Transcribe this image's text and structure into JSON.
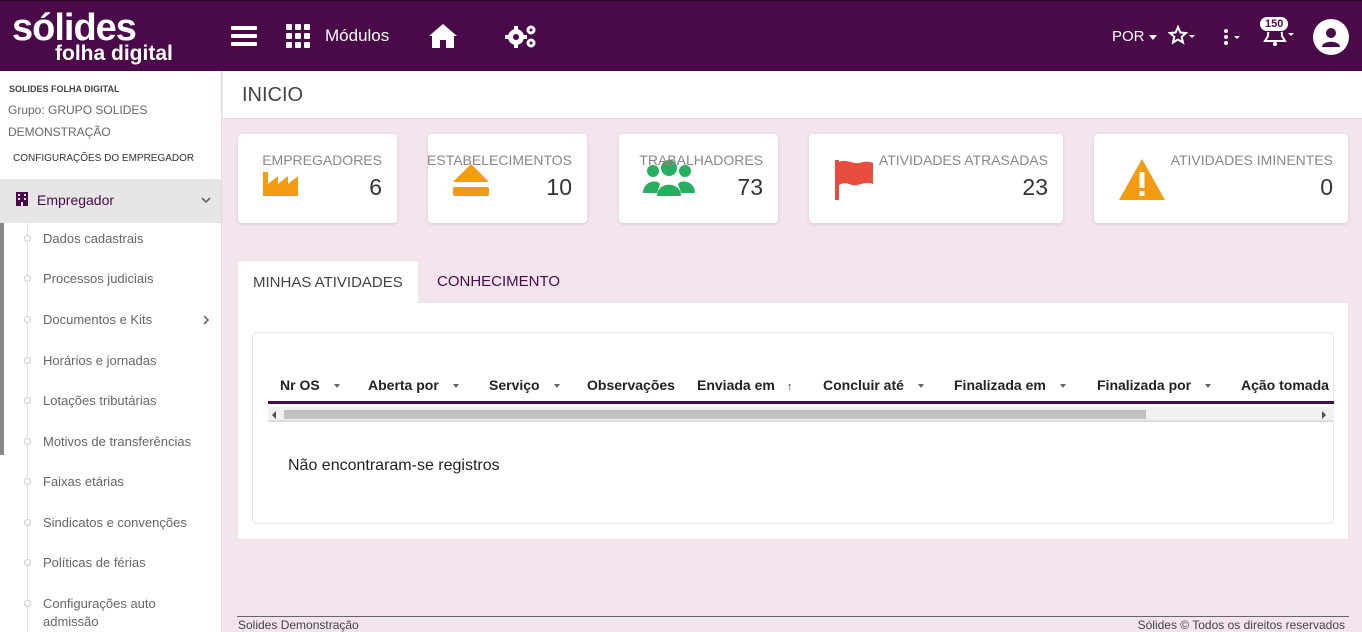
{
  "header": {
    "logo_main": "sólides",
    "logo_sub": "folha digital",
    "modules_label": "Módulos",
    "language": "POR",
    "notifications_count": "150"
  },
  "sidebar": {
    "company": "SOLIDES FOLHA DIGITAL",
    "group": "Grupo: GRUPO SOLIDES DEMONSTRAÇÃO",
    "config_title": "CONFIGURAÇÕES DO EMPREGADOR",
    "active_section": "Empregador",
    "items": [
      {
        "label": "Dados cadastrais",
        "has_submenu": false
      },
      {
        "label": "Processos judiciais",
        "has_submenu": false
      },
      {
        "label": "Documentos e Kits",
        "has_submenu": true
      },
      {
        "label": "Horários e jornadas",
        "has_submenu": false
      },
      {
        "label": "Lotações tributárias",
        "has_submenu": false
      },
      {
        "label": "Motivos de transferências",
        "has_submenu": false
      },
      {
        "label": "Faixas etárias",
        "has_submenu": false
      },
      {
        "label": "Sindicatos e convenções",
        "has_submenu": false
      },
      {
        "label": "Políticas de férias",
        "has_submenu": false
      },
      {
        "label": "Configurações auto admissão",
        "has_submenu": false
      }
    ]
  },
  "page": {
    "title": "INICIO"
  },
  "cards": [
    {
      "label": "EMPREGADORES",
      "value": "6",
      "icon": "factory-icon",
      "color": "#f39c12"
    },
    {
      "label": "ESTABELECIMENTOS",
      "value": "10",
      "icon": "eject-icon",
      "color": "#f39c12"
    },
    {
      "label": "TRABALHADORES",
      "value": "73",
      "icon": "users-icon",
      "color": "#27ae60"
    },
    {
      "label": "ATIVIDADES ATRASADAS",
      "value": "23",
      "icon": "flag-icon",
      "color": "#e74c3c"
    },
    {
      "label": "ATIVIDADES IMINENTES",
      "value": "0",
      "icon": "warning-icon",
      "color": "#f39c12"
    }
  ],
  "tabs": [
    {
      "label": "MINHAS ATIVIDADES",
      "active": true
    },
    {
      "label": "CONHECIMENTO",
      "active": false
    }
  ],
  "table": {
    "columns": [
      {
        "label": "Nr OS",
        "sort": "caret"
      },
      {
        "label": "Aberta por",
        "sort": "caret"
      },
      {
        "label": "Serviço",
        "sort": "caret"
      },
      {
        "label": "Observações",
        "sort": "none"
      },
      {
        "label": "Enviada em",
        "sort": "asc"
      },
      {
        "label": "Concluir até",
        "sort": "caret"
      },
      {
        "label": "Finalizada em",
        "sort": "caret"
      },
      {
        "label": "Finalizada por",
        "sort": "caret"
      },
      {
        "label": "Ação tomada",
        "sort": "none"
      }
    ],
    "empty_message": "Não encontraram-se registros"
  },
  "footer": {
    "left": "Solides Demonstração",
    "right": "Sólides © Todos os direitos reservados"
  },
  "colors": {
    "brand": "#4a0a4a",
    "background": "#f3e4ee"
  }
}
